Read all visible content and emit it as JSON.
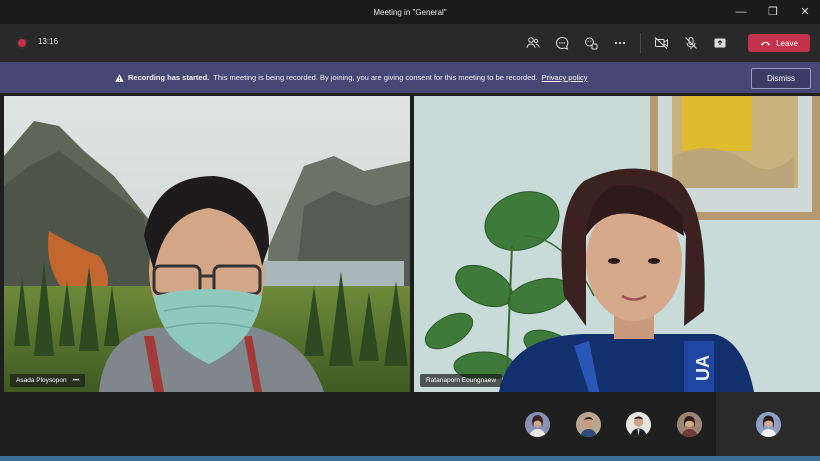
{
  "window": {
    "title": "Meeting in \"General\""
  },
  "toolbar": {
    "timer": "13:16",
    "leave_label": "Leave",
    "icons": [
      "participants-icon",
      "chat-icon",
      "reactions-icon",
      "more-icon",
      "camera-off-icon",
      "mic-off-icon",
      "share-tray-icon"
    ]
  },
  "banner": {
    "title": "Recording has started.",
    "message": "This meeting is being recorded. By joining, you are giving consent for this meeting to be recorded.",
    "link": "Privacy policy",
    "dismiss_label": "Dismiss"
  },
  "participants": {
    "left": {
      "name": "Asada Ploysopon",
      "more": "•••"
    },
    "right": {
      "name": "Ratanaporn Eoungnaew"
    }
  },
  "colors": {
    "leave": "#c4314b",
    "banner": "#464775",
    "toolbar": "#292929"
  }
}
